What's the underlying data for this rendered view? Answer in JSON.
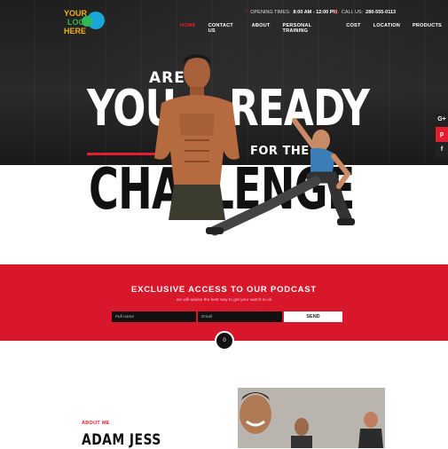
{
  "logo": {
    "line1": "YOUR",
    "line2": "LOGO",
    "line3": "HERE"
  },
  "header": {
    "hours_label": "OPENING TIMES:",
    "hours_value": "8:00 AM - 12:00 PM",
    "call_label": "CALL US:",
    "call_value": "280-555-0113"
  },
  "nav": [
    "HOME",
    "CONTACT US",
    "ABOUT",
    "PERSONAL TRAINING",
    "COST",
    "LOCATION",
    "PRODUCTS"
  ],
  "social": [
    "G+",
    "p",
    "f"
  ],
  "hero": {
    "are": "ARE",
    "you": "YOU",
    "ready": "READY",
    "forthe": "FOR THE",
    "challenge": "CHALLENGE"
  },
  "podcast": {
    "title": "EXCLUSIVE ACCESS TO OUR PODCAST",
    "subtitle": "we will advise the best way to get your watch to us",
    "name_placeholder": "Full name",
    "email_placeholder": "Email",
    "send": "SEND",
    "scroll": "0"
  },
  "about": {
    "label": "ABOUT ME",
    "name": "ADAM JESS"
  },
  "colors": {
    "accent": "#e21d2f",
    "dark": "#1e1e1e"
  }
}
